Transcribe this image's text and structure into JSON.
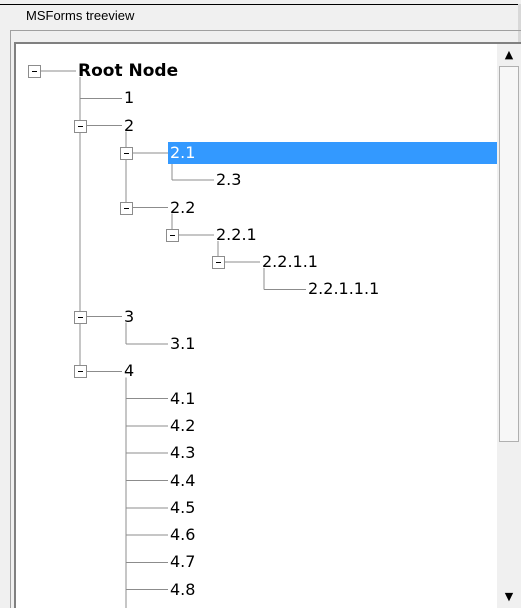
{
  "frame": {
    "caption": "MSForms treeview"
  },
  "tree": {
    "selected_node": "2.1",
    "nodes": [
      {
        "label": "Root Node",
        "depth": 0,
        "expanded": true
      },
      {
        "label": "1",
        "depth": 1
      },
      {
        "label": "2",
        "depth": 1,
        "expanded": true
      },
      {
        "label": "2.1",
        "depth": 2,
        "expanded": true
      },
      {
        "label": "2.3",
        "depth": 3
      },
      {
        "label": "2.2",
        "depth": 2,
        "expanded": true
      },
      {
        "label": "2.2.1",
        "depth": 3,
        "expanded": true
      },
      {
        "label": "2.2.1.1",
        "depth": 4,
        "expanded": true
      },
      {
        "label": "2.2.1.1.1",
        "depth": 5
      },
      {
        "label": "3",
        "depth": 1,
        "expanded": true
      },
      {
        "label": "3.1",
        "depth": 2
      },
      {
        "label": "4",
        "depth": 1,
        "expanded": true
      },
      {
        "label": "4.1",
        "depth": 2
      },
      {
        "label": "4.2",
        "depth": 2
      },
      {
        "label": "4.3",
        "depth": 2
      },
      {
        "label": "4.4",
        "depth": 2
      },
      {
        "label": "4.5",
        "depth": 2
      },
      {
        "label": "4.6",
        "depth": 2
      },
      {
        "label": "4.7",
        "depth": 2
      },
      {
        "label": "4.8",
        "depth": 2
      }
    ]
  },
  "scrollbar": {
    "up_arrow": "▲",
    "down_arrow": "▼",
    "position_fraction": 0.0
  }
}
